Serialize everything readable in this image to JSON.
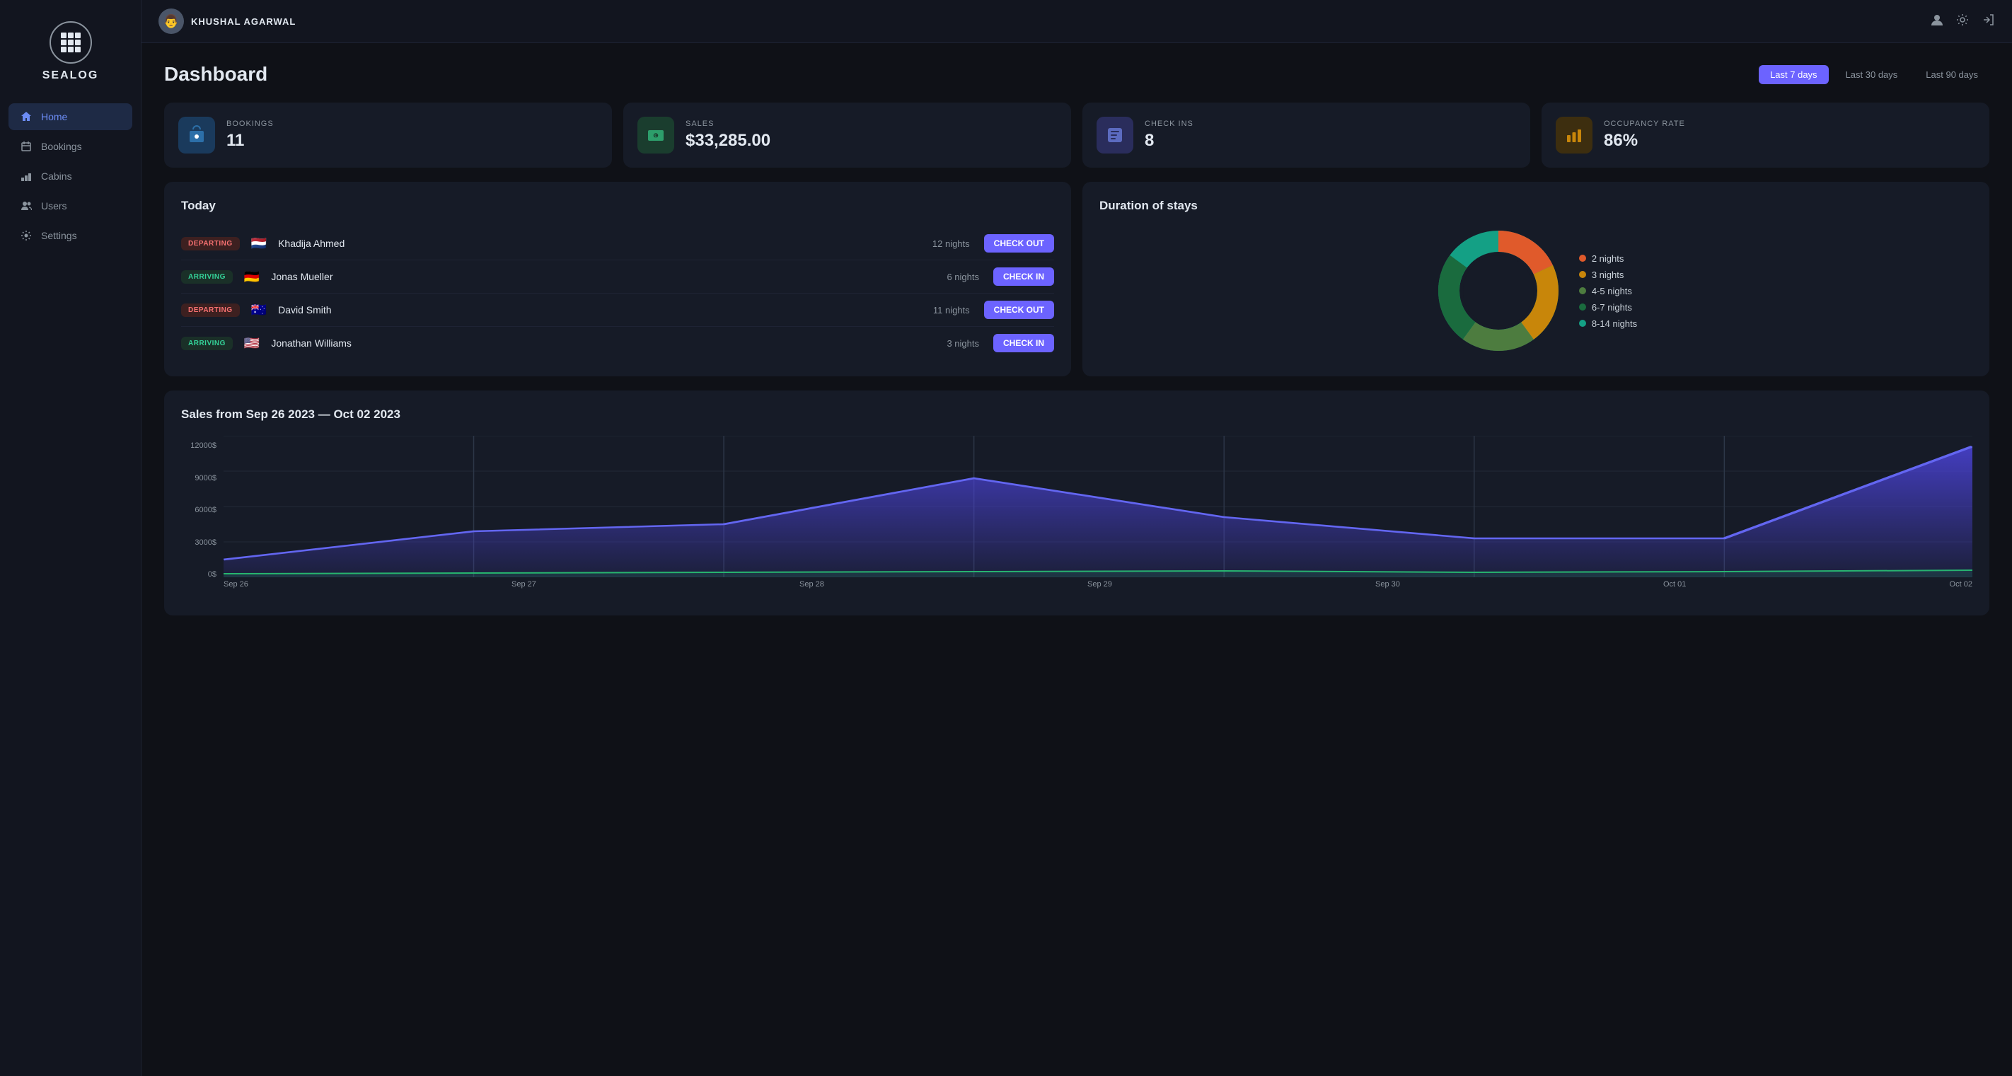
{
  "app": {
    "name": "SEALOG"
  },
  "topbar": {
    "username": "KHUSHAL AGARWAL",
    "avatar_emoji": "👨"
  },
  "sidebar": {
    "items": [
      {
        "id": "home",
        "label": "Home",
        "icon": "home",
        "active": true
      },
      {
        "id": "bookings",
        "label": "Bookings",
        "icon": "bookings",
        "active": false
      },
      {
        "id": "cabins",
        "label": "Cabins",
        "icon": "cabins",
        "active": false
      },
      {
        "id": "users",
        "label": "Users",
        "icon": "users",
        "active": false
      },
      {
        "id": "settings",
        "label": "Settings",
        "icon": "settings",
        "active": false
      }
    ]
  },
  "dashboard": {
    "title": "Dashboard",
    "filters": [
      {
        "label": "Last 7 days",
        "active": true
      },
      {
        "label": "Last 30 days",
        "active": false
      },
      {
        "label": "Last 90 days",
        "active": false
      }
    ],
    "stats": [
      {
        "id": "bookings",
        "label": "BOOKINGS",
        "value": "11",
        "icon_color": "#2c6fa8",
        "icon_bg": "#1a3a5c"
      },
      {
        "id": "sales",
        "label": "SALES",
        "value": "$33,285.00",
        "icon_color": "#2d9e6b",
        "icon_bg": "#1a3d2e"
      },
      {
        "id": "checkins",
        "label": "CHECK INS",
        "value": "8",
        "icon_color": "#5c6bc0",
        "icon_bg": "#2a2d5c"
      },
      {
        "id": "occupancy",
        "label": "OCCUPANCY RATE",
        "value": "86%",
        "icon_color": "#c8860a",
        "icon_bg": "#3d2e0f"
      }
    ],
    "today": {
      "title": "Today",
      "rows": [
        {
          "type": "DEPARTING",
          "flag": "🇳🇱",
          "name": "Khadija Ahmed",
          "nights": "12 nights",
          "action": "CHECK OUT",
          "action_type": "checkout"
        },
        {
          "type": "ARRIVING",
          "flag": "🇩🇪",
          "name": "Jonas Mueller",
          "nights": "6 nights",
          "action": "CHECK IN",
          "action_type": "checkin"
        },
        {
          "type": "DEPARTING",
          "flag": "🇦🇺",
          "name": "David Smith",
          "nights": "11 nights",
          "action": "CHECK OUT",
          "action_type": "checkout"
        },
        {
          "type": "ARRIVING",
          "flag": "🇺🇸",
          "name": "Jonathan Williams",
          "nights": "3 nights",
          "action": "CHECK IN",
          "action_type": "checkin"
        }
      ]
    },
    "duration_of_stays": {
      "title": "Duration of stays",
      "legend": [
        {
          "label": "2 nights",
          "color": "#e05a2b"
        },
        {
          "label": "3 nights",
          "color": "#c8860a"
        },
        {
          "label": "4-5 nights",
          "color": "#4d7c3f"
        },
        {
          "label": "6-7 nights",
          "color": "#1a6b3e"
        },
        {
          "label": "8-14 nights",
          "color": "#14a085"
        }
      ],
      "segments": [
        {
          "percent": 18,
          "color": "#e05a2b"
        },
        {
          "percent": 22,
          "color": "#c8860a"
        },
        {
          "percent": 20,
          "color": "#4d7c3f"
        },
        {
          "percent": 25,
          "color": "#1a6b3e"
        },
        {
          "percent": 15,
          "color": "#14a085"
        }
      ]
    },
    "sales_chart": {
      "title": "Sales from Sep 26 2023 — Oct 02 2023",
      "y_labels": [
        "12000$",
        "9000$",
        "6000$",
        "3000$",
        "0$"
      ],
      "x_labels": [
        "Sep 26",
        "Sep 27",
        "Sep 28",
        "Sep 29",
        "Sep 30",
        "Oct 01",
        "Oct 02"
      ],
      "primary_color": "#4f46e5",
      "secondary_color": "#22c55e"
    }
  }
}
